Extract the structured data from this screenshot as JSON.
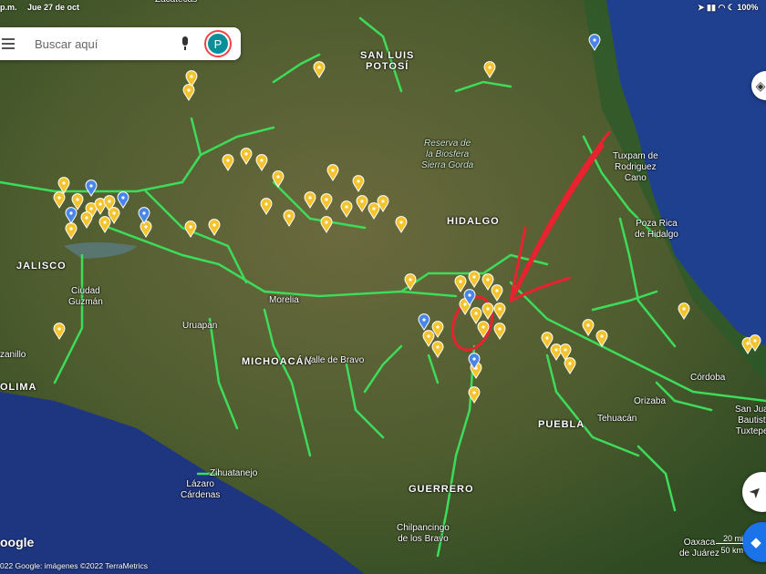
{
  "status_bar": {
    "time": "p.m.",
    "date": "Jue 27 de oct",
    "battery": "100%"
  },
  "search": {
    "placeholder": "Buscar aquí",
    "avatar_letter": "P"
  },
  "map_labels": {
    "zacatecas": "Zacatecas",
    "san_luis": "SAN LUIS\nPOTOSÍ",
    "sierra_gorda": "Reserva de\nla Biosfera\nSierra Gorda",
    "tuxpam": "Tuxpam de\nRodriguez\nCano",
    "hidalgo": "HIDALGO",
    "poza_rica": "Poza Rica\nde Hidalgo",
    "jalisco": "JALISCO",
    "ciudad_guzman": "Ciudad\nGuzmán",
    "morelia": "Morelia",
    "uruapan": "Uruapan",
    "michoacan": "MICHOACÁN",
    "valle_bravo": "Valle de Bravo",
    "manzanillo": "zanillo",
    "colima": "OLIMA",
    "cordoba": "Córdoba",
    "orizaba": "Orizaba",
    "puebla": "PUEBLA",
    "tehuacan": "Tehuacán",
    "tuxtepec": "San Juan\nBautista\nTuxtepec",
    "guerrero": "GUERRERO",
    "lazaro": "Lázaro\nCárdenas",
    "zihuatanejo": "Zihuatanejo",
    "chilpancingo": "Chilpancingo\nde los Bravo",
    "oaxaca": "Oaxaca\nde Juárez"
  },
  "scale": {
    "mi": "20 mi",
    "km": "50 km"
  },
  "logo": "oogle",
  "attribution": "022 Google: imágenes ©2022 TerraMetrics",
  "colors": {
    "road": "#3ddc5a",
    "pin_yellow": "#f4c430",
    "pin_blue": "#4a86e8",
    "annotation": "#e8222f",
    "ocean": "#1e3a8a"
  }
}
